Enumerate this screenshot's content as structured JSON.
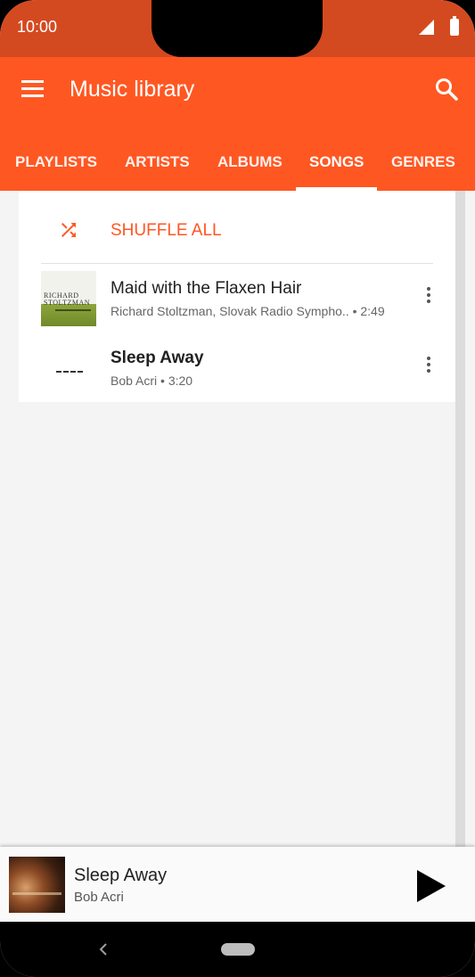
{
  "status_bar": {
    "time": "10:00"
  },
  "toolbar": {
    "title": "Music library"
  },
  "tabs": [
    {
      "label": "PLAYLISTS"
    },
    {
      "label": "ARTISTS"
    },
    {
      "label": "ALBUMS"
    },
    {
      "label": "SONGS",
      "active": true
    },
    {
      "label": "GENRES"
    }
  ],
  "shuffle": {
    "label": "SHUFFLE ALL"
  },
  "songs": [
    {
      "title": "Maid with the Flaxen Hair",
      "subtitle": "Richard Stoltzman, Slovak Radio Sympho.. • 2:49",
      "art_text": [
        "RICHARD",
        "STOLTZMAN"
      ]
    },
    {
      "title": "Sleep Away",
      "subtitle": "Bob Acri • 3:20"
    }
  ],
  "now_playing": {
    "title": "Sleep Away",
    "artist": "Bob Acri"
  },
  "colors": {
    "status_bar": "#d44a20",
    "accent": "#ff5722",
    "background": "#f4f4f4"
  },
  "icons": {
    "menu": "menu-icon",
    "search": "search-icon",
    "shuffle": "shuffle-icon",
    "more": "more-vert-icon",
    "play": "play-icon",
    "back": "back-icon"
  }
}
